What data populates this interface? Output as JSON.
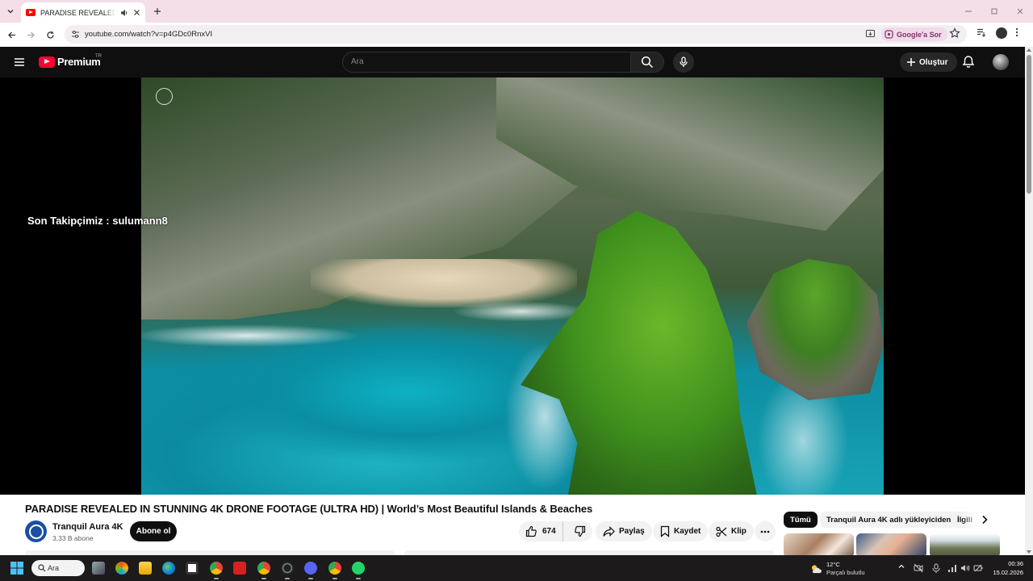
{
  "browser": {
    "tab_title": "PARADISE REVEALED IN STUNNING 4K DRONE FOOTAGE (ULTRA HD) | World's Most Beautiful Islands & Beaches",
    "url": "youtube.com/watch?v=p4GDc0RnxVI",
    "google_ask_label": "Google'a Sor"
  },
  "youtube": {
    "logo_text": "Premium",
    "country_code": "TR",
    "search_placeholder": "Ara",
    "create_label": "Oluştur"
  },
  "player": {
    "overlay_text": "Son Takipçimiz : sulumann8"
  },
  "video": {
    "title": "PARADISE REVEALED IN STUNNING 4K DRONE FOOTAGE (ULTRA HD) | World’s Most Beautiful Islands & Beaches",
    "channel_name": "Tranquil Aura 4K",
    "subscribers": "3,33 B abone",
    "subscribe_label": "Abone ol",
    "like_count": "674",
    "share_label": "Paylaş",
    "save_label": "Kaydet",
    "clip_label": "Klip"
  },
  "chips": [
    "Tümü",
    "Tranquil Aura 4K adlı yükleyiciden",
    "İlgili"
  ],
  "taskbar": {
    "search_label": "Ara",
    "weather_temp": "12°C",
    "weather_desc": "Parçalı bulutlu",
    "time": "00:36",
    "date": "15.02.2026"
  },
  "colors": {
    "youtube_red": "#ff0033",
    "tab_strip": "#f4dfe9",
    "yt_header": "#0f0f0f"
  }
}
